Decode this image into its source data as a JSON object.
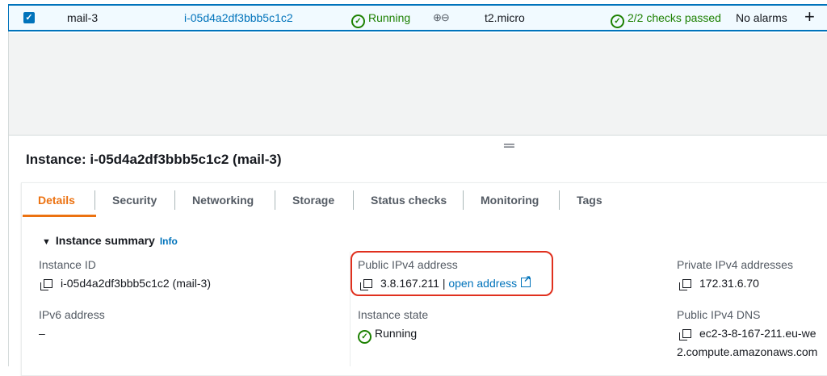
{
  "row": {
    "name": "mail-3",
    "instance_id": "i-05d4a2df3bbb5c1c2",
    "state": "Running",
    "type": "t2.micro",
    "checks": "2/2 checks passed",
    "alarms": "No alarms",
    "add": "+"
  },
  "details": {
    "title": "Instance: i-05d4a2df3bbb5c1c2 (mail-3)",
    "tabs": [
      "Details",
      "Security",
      "Networking",
      "Storage",
      "Status checks",
      "Monitoring",
      "Tags"
    ],
    "active_tab": "Details",
    "summary": {
      "heading": "Instance summary",
      "info": "Info",
      "instance_id_label": "Instance ID",
      "instance_id_value": "i-05d4a2df3bbb5c1c2 (mail-3)",
      "public_ipv4_label": "Public IPv4 address",
      "public_ipv4_value": "3.8.167.211",
      "separator": "|",
      "open_address": "open address",
      "private_ipv4_label": "Private IPv4 addresses",
      "private_ipv4_value": "172.31.6.70",
      "ipv6_label": "IPv6 address",
      "ipv6_value": "–",
      "instance_state_label": "Instance state",
      "instance_state_value": "Running",
      "public_dns_label": "Public IPv4 DNS",
      "public_dns_value_line1": "ec2-3-8-167-211.eu-we",
      "public_dns_value_line2": "2.compute.amazonaws.com"
    }
  },
  "colors": {
    "accent": "#ec7211",
    "link": "#0073bb",
    "success": "#1d8102",
    "highlight": "#e0301e"
  }
}
